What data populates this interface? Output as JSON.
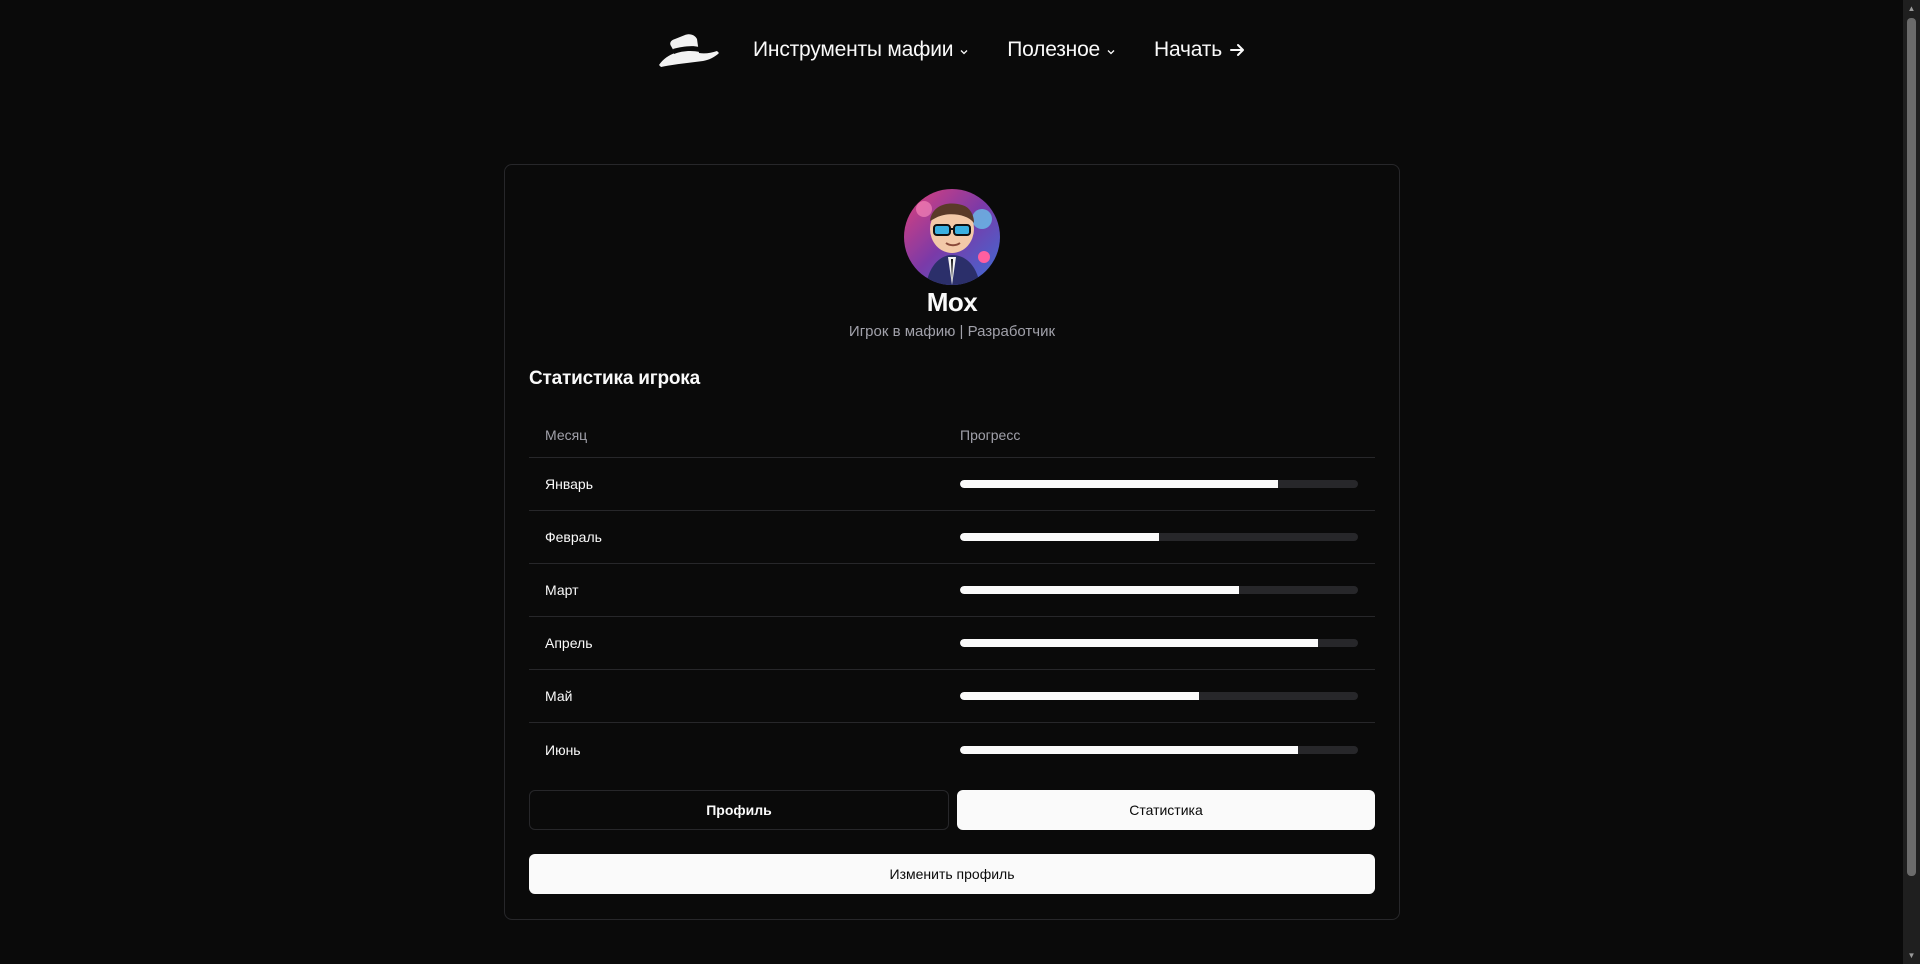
{
  "header": {
    "logo": "mafia-hat-logo",
    "nav": [
      {
        "label": "Инструменты мафии",
        "icon": "chevron-down-icon"
      },
      {
        "label": "Полезное",
        "icon": "chevron-down-icon"
      },
      {
        "label": "Начать",
        "icon": "arrow-right-icon"
      }
    ]
  },
  "profile": {
    "avatar": "cartoon-character-with-sunglasses",
    "name": "Mox",
    "role": "Игрок в мафию | Разработчик"
  },
  "stats": {
    "title": "Статистика игрока",
    "columns": {
      "month": "Месяц",
      "progress": "Прогресс"
    },
    "rows": [
      {
        "month": "Январь",
        "progress": 80
      },
      {
        "month": "Февраль",
        "progress": 50
      },
      {
        "month": "Март",
        "progress": 70
      },
      {
        "month": "Апрель",
        "progress": 90
      },
      {
        "month": "Май",
        "progress": 60
      },
      {
        "month": "Июнь",
        "progress": 85
      }
    ]
  },
  "tabs": {
    "profile": "Профиль",
    "statistics": "Статистика",
    "active": "statistics"
  },
  "actions": {
    "edit_profile": "Изменить профиль"
  },
  "colors": {
    "background": "#0a0a0a",
    "foreground": "#fafafa",
    "muted": "#a1a1aa",
    "border": "#27272a"
  }
}
